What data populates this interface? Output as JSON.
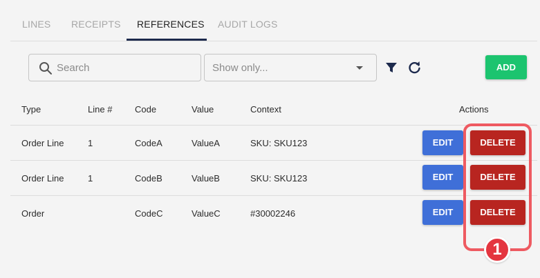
{
  "tabs": [
    {
      "label": "LINES"
    },
    {
      "label": "RECEIPTS"
    },
    {
      "label": "REFERENCES"
    },
    {
      "label": "AUDIT LOGS"
    }
  ],
  "active_tab": "REFERENCES",
  "toolbar": {
    "search_placeholder": "Search",
    "search_value": "",
    "filter_select_placeholder": "Show only...",
    "filter_icon": "filter-icon",
    "refresh_icon": "refresh-icon",
    "add_label": "ADD"
  },
  "table": {
    "columns": [
      "Type",
      "Line #",
      "Code",
      "Value",
      "Context",
      "Actions"
    ],
    "rows": [
      {
        "type": "Order Line",
        "line": "1",
        "code": "CodeA",
        "value": "ValueA",
        "context": "SKU: SKU123"
      },
      {
        "type": "Order Line",
        "line": "1",
        "code": "CodeB",
        "value": "ValueB",
        "context": "SKU: SKU123"
      },
      {
        "type": "Order",
        "line": "",
        "code": "CodeC",
        "value": "ValueC",
        "context": "#30002246"
      }
    ],
    "edit_label": "EDIT",
    "delete_label": "DELETE"
  },
  "callout": {
    "number": "1"
  },
  "colors": {
    "add": "#1cc46f",
    "edit": "#3f6fd8",
    "delete": "#b82520",
    "callout": "#ee5a61",
    "tab_active": "#1d2a4d"
  }
}
